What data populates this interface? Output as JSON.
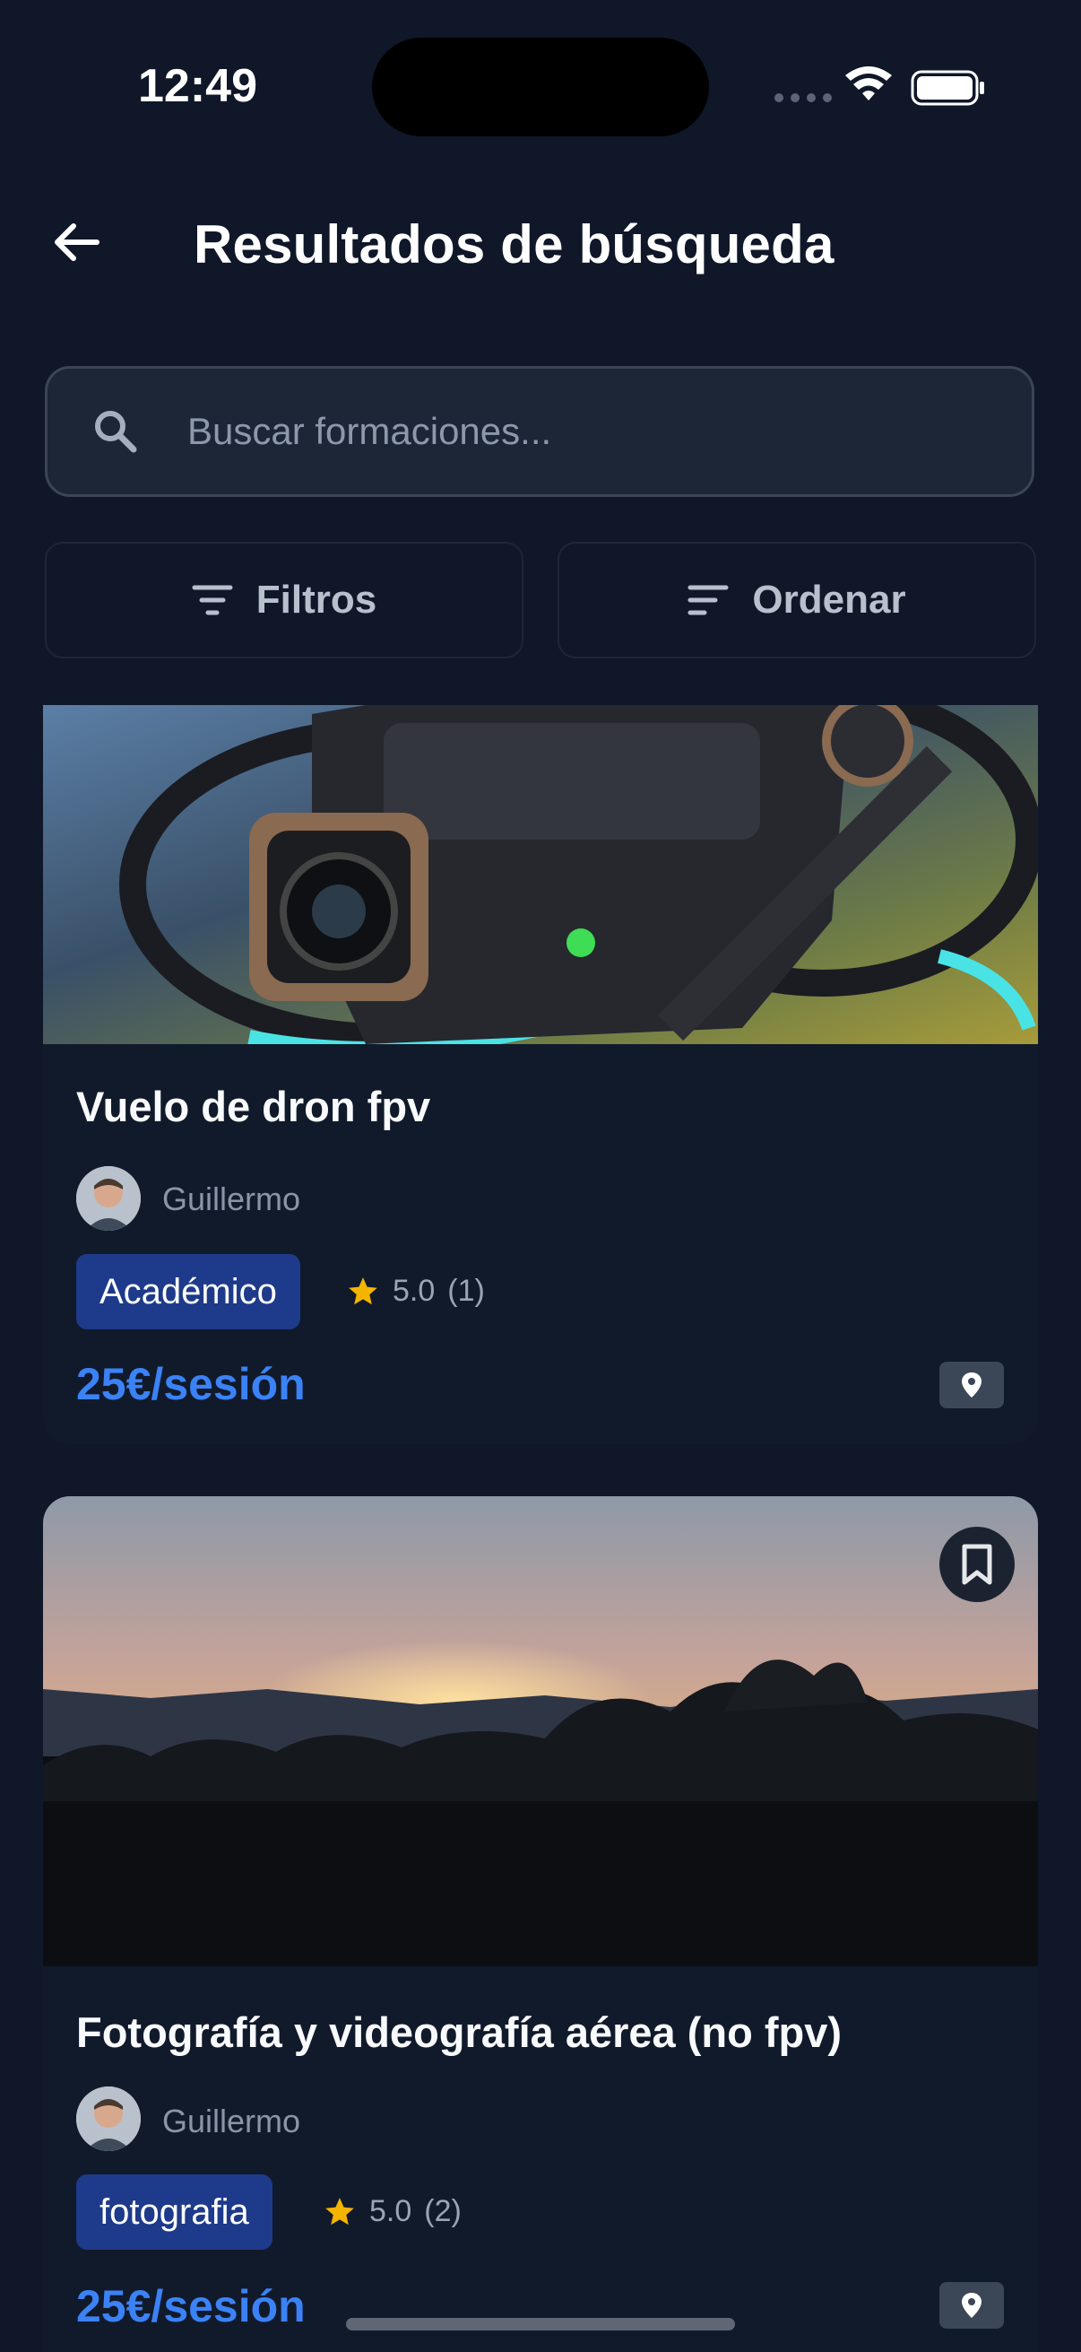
{
  "status_bar": {
    "time": "12:49"
  },
  "header": {
    "title": "Resultados de búsqueda"
  },
  "search": {
    "placeholder": "Buscar formaciones..."
  },
  "toolbar": {
    "filters_label": "Filtros",
    "sort_label": "Ordenar"
  },
  "results": [
    {
      "title": "Vuelo de dron fpv",
      "instructor": "Guillermo",
      "tag": "Académico",
      "rating": "5.0",
      "reviews": "(1)",
      "price": "25€/sesión",
      "image": "fpv-drone-photo"
    },
    {
      "title": "Fotografía y videografía aérea (no fpv)",
      "instructor": "Guillermo",
      "tag": "fotografia",
      "rating": "5.0",
      "reviews": "(2)",
      "price": "25€/sesión",
      "image": "sunset-landscape-photo"
    }
  ],
  "colors": {
    "background": "#0f1729",
    "accent": "#3b82f6",
    "tag": "#1e3a8a",
    "star": "#f5b400"
  }
}
